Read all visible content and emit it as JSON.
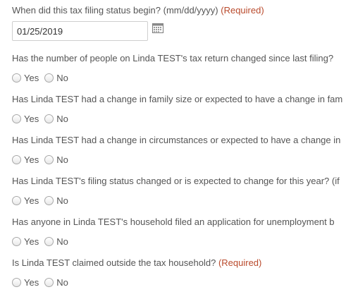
{
  "date_question": {
    "label": "When did this tax filing status begin? (mm/dd/yyyy)",
    "required": "(Required)",
    "value": "01/25/2019",
    "calendar_icon": "calendar-icon"
  },
  "questions": [
    {
      "label": "Has the number of people on Linda TEST's tax return changed since last filing?",
      "required": "",
      "yes": "Yes",
      "no": "No"
    },
    {
      "label": "Has Linda TEST had a change in family size or expected to have a change in fam",
      "required": "",
      "yes": "Yes",
      "no": "No"
    },
    {
      "label": "Has Linda TEST had a change in circumstances or expected to have a change in",
      "required": "",
      "yes": "Yes",
      "no": "No"
    },
    {
      "label": "Has Linda TEST's filing status changed or is expected to change for this year? (if",
      "required": "",
      "yes": "Yes",
      "no": "No"
    },
    {
      "label": "Has anyone in Linda TEST's household filed an application for unemployment b",
      "required": "",
      "yes": "Yes",
      "no": "No"
    },
    {
      "label": "Is Linda TEST claimed outside the tax household?",
      "required": "(Required)",
      "yes": "Yes",
      "no": "No"
    }
  ],
  "colors": {
    "text": "#555555",
    "required": "#b94a2c",
    "input_border": "#cfcfcf"
  }
}
